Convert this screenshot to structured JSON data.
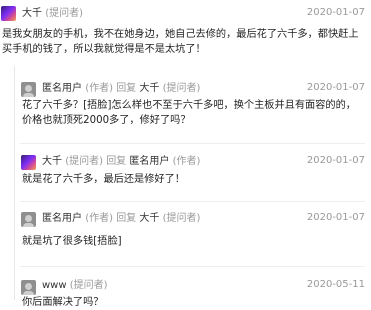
{
  "comments": [
    {
      "author": "大千",
      "role": "(提问者)",
      "date": "2020-01-07",
      "content": "是我女朋友的手机，我不在她身边，她自己去修的，最后花了六千多，都快赶上买手机的钱了，所以我就觉得是不是太坑了！"
    },
    {
      "author": "匿名用户",
      "role": "(作者)",
      "reply": "回复",
      "reply_to": "大千",
      "reply_to_role": "(提问者)",
      "date": "2020-01-07",
      "content": "花了六千多？[捂脸]怎么样也不至于六千多吧，换个主板并且有面容的的，价格也就顶死2000多了，修好了吗？"
    },
    {
      "author": "大千",
      "role": "(提问者)",
      "reply": "回复",
      "reply_to": "匿名用户",
      "reply_to_role": "(作者)",
      "date": "2020-01-07",
      "content": "就是花了六千多，最后还是修好了！"
    },
    {
      "author": "匿名用户",
      "role": "(作者)",
      "reply": "回复",
      "reply_to": "大千",
      "reply_to_role": "(提问者)",
      "date": "2020-01-07",
      "content": "就是坑了很多钱[捂脸]"
    },
    {
      "author": "www",
      "role": "(提问者)",
      "date": "2020-05-11",
      "content": "你后面解决了吗？"
    }
  ]
}
